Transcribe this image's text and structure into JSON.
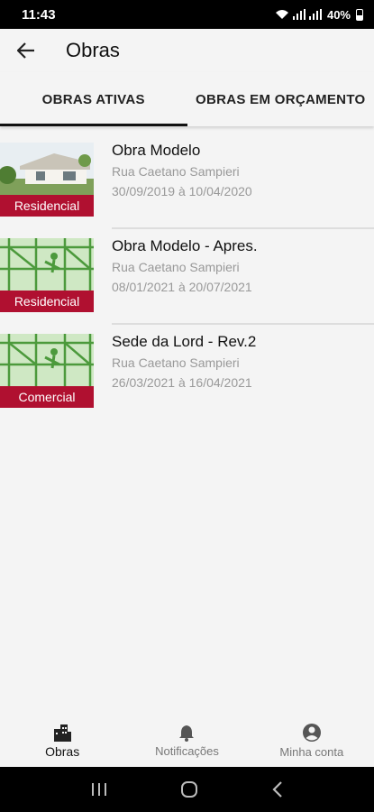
{
  "status_bar": {
    "time": "11:43",
    "battery": "40%"
  },
  "app_bar": {
    "title": "Obras"
  },
  "tabs": [
    {
      "label": "OBRAS ATIVAS",
      "active": true
    },
    {
      "label": "OBRAS EM ORÇAMENTO",
      "active": false
    }
  ],
  "obras": [
    {
      "title": "Obra Modelo",
      "address": "Rua Caetano Sampieri",
      "dates": "30/09/2019 à 10/04/2020",
      "category": "Residencial"
    },
    {
      "title": "Obra Modelo - Apres.",
      "address": "Rua Caetano Sampieri",
      "dates": "08/01/2021 à 20/07/2021",
      "category": "Residencial"
    },
    {
      "title": "Sede da Lord - Rev.2",
      "address": "Rua Caetano Sampieri",
      "dates": "26/03/2021 à 16/04/2021",
      "category": "Comercial"
    }
  ],
  "bottom_nav": [
    {
      "label": "Obras",
      "icon": "buildings-icon",
      "active": true
    },
    {
      "label": "Notificações",
      "icon": "bell-icon",
      "active": false
    },
    {
      "label": "Minha conta",
      "icon": "account-circle-icon",
      "active": false
    }
  ],
  "colors": {
    "badge": "#b01030",
    "accent": "#111111"
  }
}
